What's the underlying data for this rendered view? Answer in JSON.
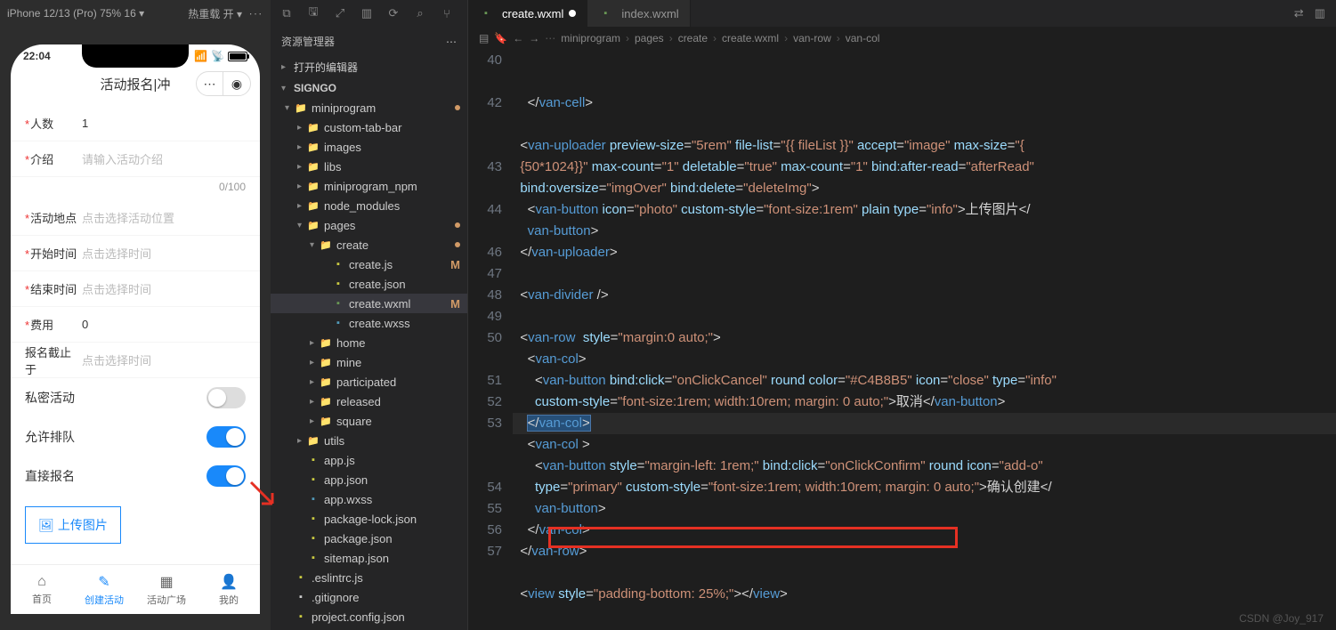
{
  "sim": {
    "device": "iPhone 12/13 (Pro) 75% 16 ▾",
    "reload": "热重载 开 ▾",
    "dots": "∙∙∙",
    "time": "22:04",
    "page_title": "活动报名|冲",
    "fields": {
      "people": {
        "label": "人数",
        "value": "1",
        "required": true
      },
      "intro": {
        "label": "介绍",
        "placeholder": "请输入活动介绍",
        "required": true
      },
      "counter": "0/100",
      "place": {
        "label": "活动地点",
        "placeholder": "点击选择活动位置",
        "required": true
      },
      "start": {
        "label": "开始时间",
        "placeholder": "点击选择时间",
        "required": true
      },
      "end": {
        "label": "结束时间",
        "placeholder": "点击选择时间",
        "required": true
      },
      "fee": {
        "label": "费用",
        "value": "0",
        "required": true
      },
      "deadline": {
        "label": "报名截止于",
        "placeholder": "点击选择时间",
        "required": false
      }
    },
    "switches": {
      "private": "私密活动",
      "queue": "允许排队",
      "direct": "直接报名"
    },
    "upload": "上传图片",
    "cancel": "取消",
    "confirm": "确认创建",
    "tabs": [
      "首页",
      "创建活动",
      "活动广场",
      "我的"
    ]
  },
  "explorer": {
    "title": "资源管理器",
    "opened": "打开的编辑器",
    "project": "SIGNGO",
    "tree": [
      {
        "t": "folder",
        "l": "miniprogram",
        "d": 1,
        "open": true,
        "dot": true
      },
      {
        "t": "folder",
        "l": "custom-tab-bar",
        "d": 2
      },
      {
        "t": "folder",
        "l": "images",
        "d": 2
      },
      {
        "t": "folder",
        "l": "libs",
        "d": 2
      },
      {
        "t": "folder",
        "l": "miniprogram_npm",
        "d": 2
      },
      {
        "t": "folder",
        "l": "node_modules",
        "d": 2,
        "muted": true
      },
      {
        "t": "folder",
        "l": "pages",
        "d": 2,
        "open": true,
        "dot": true
      },
      {
        "t": "folder",
        "l": "create",
        "d": 3,
        "open": true,
        "dot": true
      },
      {
        "t": "file",
        "l": "create.js",
        "d": 4,
        "c": "file-js",
        "m": true
      },
      {
        "t": "file",
        "l": "create.json",
        "d": 4,
        "c": "file-json"
      },
      {
        "t": "file",
        "l": "create.wxml",
        "d": 4,
        "c": "file-wxml",
        "m": true,
        "active": true
      },
      {
        "t": "file",
        "l": "create.wxss",
        "d": 4,
        "c": "file-wxss"
      },
      {
        "t": "folder",
        "l": "home",
        "d": 3
      },
      {
        "t": "folder",
        "l": "mine",
        "d": 3
      },
      {
        "t": "folder",
        "l": "participated",
        "d": 3
      },
      {
        "t": "folder",
        "l": "released",
        "d": 3
      },
      {
        "t": "folder",
        "l": "square",
        "d": 3
      },
      {
        "t": "folder",
        "l": "utils",
        "d": 2
      },
      {
        "t": "file",
        "l": "app.js",
        "d": 2,
        "c": "file-js"
      },
      {
        "t": "file",
        "l": "app.json",
        "d": 2,
        "c": "file-json"
      },
      {
        "t": "file",
        "l": "app.wxss",
        "d": 2,
        "c": "file-wxss"
      },
      {
        "t": "file",
        "l": "package-lock.json",
        "d": 2,
        "c": "file-json"
      },
      {
        "t": "file",
        "l": "package.json",
        "d": 2,
        "c": "file-json"
      },
      {
        "t": "file",
        "l": "sitemap.json",
        "d": 2,
        "c": "file-json"
      },
      {
        "t": "file",
        "l": ".eslintrc.js",
        "d": 1,
        "c": "file-js"
      },
      {
        "t": "file",
        "l": ".gitignore",
        "d": 1,
        "c": "file-txt"
      },
      {
        "t": "file",
        "l": "project.config.json",
        "d": 1,
        "c": "file-json"
      }
    ]
  },
  "editor": {
    "tabs": [
      {
        "name": "create.wxml",
        "active": true,
        "mod": true
      },
      {
        "name": "index.wxml",
        "active": false
      }
    ],
    "crumbs": [
      "miniprogram",
      "pages",
      "create",
      "create.wxml",
      "van-row",
      "van-col"
    ],
    "lines": [
      {
        "n": 40,
        "html": "    &lt;/<span class='t-tag'>van-cell</span>&gt;"
      },
      {
        "n": "",
        "html": ""
      },
      {
        "n": 42,
        "html": "  &lt;<span class='t-tag'>van-uploader</span> <span class='t-attr'>preview-size</span>=<span class='t-str'>\"5rem\"</span> <span class='t-attr'>file-list</span>=<span class='t-str'>\"{{ fileList }}\"</span> <span class='t-attr'>accept</span>=<span class='t-str'>\"image\"</span> <span class='t-attr'>max-size</span>=<span class='t-str'>\"{</span>"
      },
      {
        "n": "",
        "html": "  <span class='t-str'>{50*1024}}\"</span> <span class='t-attr'>max-count</span>=<span class='t-str'>\"1\"</span> <span class='t-attr'>deletable</span>=<span class='t-str'>\"true\"</span> <span class='t-attr'>max-count</span>=<span class='t-str'>\"1\"</span> <span class='t-attr'>bind:after-read</span>=<span class='t-str'>\"afterRead\"</span>"
      },
      {
        "n": "",
        "html": "  <span class='t-attr'>bind:oversize</span>=<span class='t-str'>\"imgOver\"</span> <span class='t-attr'>bind:delete</span>=<span class='t-str'>\"deleteImg\"</span>&gt;"
      },
      {
        "n": 43,
        "html": "    &lt;<span class='t-tag'>van-button</span> <span class='t-attr'>icon</span>=<span class='t-str'>\"photo\"</span> <span class='t-attr'>custom-style</span>=<span class='t-str'>\"font-size:1rem\"</span> <span class='t-attr'>plain</span> <span class='t-attr'>type</span>=<span class='t-str'>\"info\"</span>&gt;上传图片&lt;/"
      },
      {
        "n": "",
        "html": "    <span class='t-tag'>van-button</span>&gt;"
      },
      {
        "n": 44,
        "html": "  &lt;/<span class='t-tag'>van-uploader</span>&gt;"
      },
      {
        "n": "",
        "html": ""
      },
      {
        "n": 46,
        "html": "  &lt;<span class='t-tag'>van-divider</span> /&gt;"
      },
      {
        "n": 47,
        "html": ""
      },
      {
        "n": 48,
        "html": "  &lt;<span class='t-tag'>van-row</span>  <span class='t-attr'>style</span>=<span class='t-str'>\"margin:0 auto;\"</span>&gt;"
      },
      {
        "n": 49,
        "html": "    &lt;<span class='t-tag'>van-col</span>&gt;"
      },
      {
        "n": 50,
        "html": "      &lt;<span class='t-tag'>van-button</span> <span class='t-attr'>bind:click</span>=<span class='t-str'>\"onClickCancel\"</span> <span class='t-attr'>round</span> <span class='t-attr'>color</span>=<span class='t-str'>\"#C4B8B5\"</span> <span class='t-attr'>icon</span>=<span class='t-str'>\"close\"</span> <span class='t-attr'>type</span>=<span class='t-str'>\"info\"</span>"
      },
      {
        "n": "",
        "html": "      <span class='t-attr'>custom-style</span>=<span class='t-str'>\"font-size:1rem; width:10rem; margin: 0 auto;\"</span>&gt;取消&lt;/<span class='t-tag'>van-button</span>&gt;"
      },
      {
        "n": 51,
        "html": "    <span class='sel'>&lt;/<span class='t-tag'>van-col</span>&gt;</span>",
        "hl": true
      },
      {
        "n": 52,
        "html": "    &lt;<span class='t-tag'>van-col</span> &gt;"
      },
      {
        "n": 53,
        "html": "      &lt;<span class='t-tag'>van-button</span> <span class='t-attr'>style</span>=<span class='t-str'>\"margin-left: 1rem;\"</span> <span class='t-attr'>bind:click</span>=<span class='t-str'>\"onClickConfirm\"</span> <span class='t-attr'>round</span> <span class='t-attr'>icon</span>=<span class='t-str'>\"add-o\"</span>"
      },
      {
        "n": "",
        "html": "      <span class='t-attr'>type</span>=<span class='t-str'>\"primary\"</span> <span class='t-attr'>custom-style</span>=<span class='t-str'>\"font-size:1rem; width:10rem; margin: 0 auto;\"</span>&gt;确认创建&lt;/"
      },
      {
        "n": "",
        "html": "      <span class='t-tag'>van-button</span>&gt;"
      },
      {
        "n": 54,
        "html": "    &lt;/<span class='t-tag'>van-col</span>&gt;"
      },
      {
        "n": 55,
        "html": "  &lt;/<span class='t-tag'>van-row</span>&gt;"
      },
      {
        "n": 56,
        "html": ""
      },
      {
        "n": 57,
        "html": "  &lt;<span class='t-tag'>view</span> <span class='t-attr'>style</span>=<span class='t-str'>\"padding-bottom: 25%;\"</span>&gt;&lt;/<span class='t-tag'>view</span>&gt;"
      }
    ]
  },
  "watermark": "CSDN @Joy_917"
}
